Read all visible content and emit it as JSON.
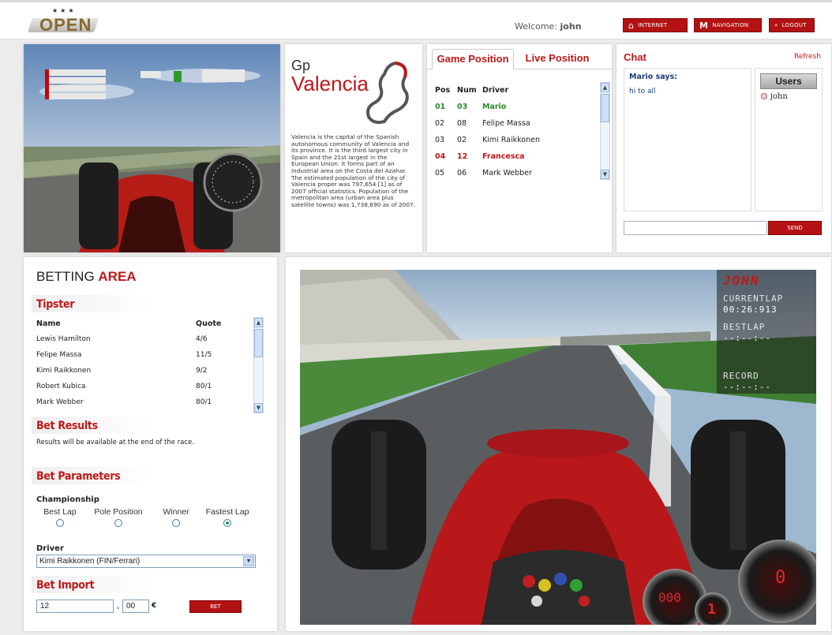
{
  "header": {
    "logo_text": "OPEN",
    "welcome_label": "Welcome:",
    "username": "john",
    "buttons": {
      "internet": "INTERNET",
      "navigation": "NAVIGATION",
      "logout": "LOGOUT"
    }
  },
  "track": {
    "title_small": "Gp",
    "title_big": "Valencia",
    "description": "Valencia is the capital of the Spanish autonomous community of Valencia and its province. It is the third largest city in Spain and the 21st largest in the European Union. It forms part of an industrial area on the Costa del Azahar. The estimated population of the city of Valencia proper was 797,654 [1] as of 2007 official statistics. Population of the metropolitan area (urban area plus satellite towns) was 1,738,690 as of 2007."
  },
  "positions": {
    "tabs": [
      "Game Position",
      "Live Position"
    ],
    "headers": {
      "pos": "Pos",
      "num": "Num",
      "driver": "Driver"
    },
    "rows": [
      {
        "pos": "01",
        "num": "03",
        "driver": "Mario",
        "style": "green"
      },
      {
        "pos": "02",
        "num": "08",
        "driver": "Felipe Massa",
        "style": "normal"
      },
      {
        "pos": "03",
        "num": "02",
        "driver": "Kimi Raikkonen",
        "style": "normal"
      },
      {
        "pos": "04",
        "num": "12",
        "driver": "Francesca",
        "style": "red"
      },
      {
        "pos": "05",
        "num": "06",
        "driver": "Mark Webber",
        "style": "normal"
      }
    ]
  },
  "chat": {
    "title": "Chat",
    "refresh": "Refresh",
    "speaker": "Mario says:",
    "message": "hi to all",
    "users_label": "Users",
    "users": [
      "john"
    ],
    "input_value": "",
    "send": "SEND"
  },
  "betting": {
    "title_a": "BETTING",
    "title_b": "AREA",
    "tipster_heading": "Tipster",
    "tipster_headers": {
      "name": "Name",
      "quote": "Quote"
    },
    "tipsters": [
      {
        "name": "Lewis Hamilton",
        "quote": "4/6"
      },
      {
        "name": "Felipe Massa",
        "quote": "11/5"
      },
      {
        "name": "Kimi Raikkonen",
        "quote": "9/2"
      },
      {
        "name": "Robert Kubica",
        "quote": "80/1"
      },
      {
        "name": "Mark Webber",
        "quote": "80/1"
      }
    ],
    "results_heading": "Bet Results",
    "results_text": "Results will be available at the end of the race.",
    "params_heading": "Bet Parameters",
    "championship_label": "Championship",
    "options": [
      "Best Lap",
      "Pole Position",
      "Winner",
      "Fastest Lap"
    ],
    "selected_option": "Fastest Lap",
    "driver_label": "Driver",
    "driver_value": "Kimi Raikkonen (FIN/Ferrari)",
    "import_heading": "Bet Import",
    "amount_int": "12",
    "amount_sep": ",",
    "amount_dec": "00",
    "currency": "€",
    "bet_button": "BET"
  },
  "hud": {
    "player": "JOHN",
    "current_lap_label": "CURRENTLAP",
    "current_lap": "00:26:913",
    "best_lap_label": "BESTLAP",
    "best_lap": "--:--:--",
    "record_label": "RECORD",
    "record": "--:--:--",
    "speed": "000",
    "gear": "1",
    "rpm": "0"
  }
}
